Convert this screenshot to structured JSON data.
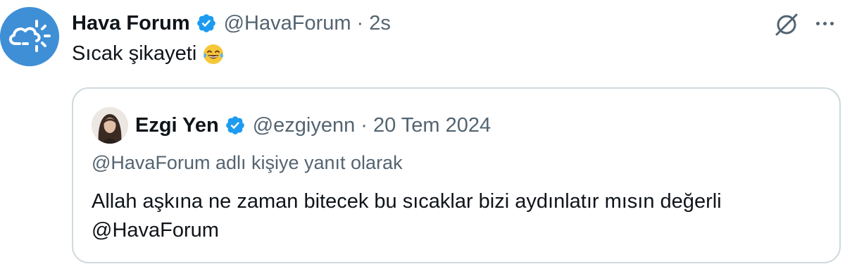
{
  "tweet": {
    "author_name": "Hava Forum",
    "author_handle": "@HavaForum",
    "separator": "·",
    "time": "2s",
    "text": "Sıcak şikayeti",
    "emoji": "face-with-tears-of-joy"
  },
  "quoted_tweet": {
    "author_name": "Ezgi Yen",
    "author_handle": "@ezgiyenn",
    "separator": "·",
    "date": "20 Tem 2024",
    "reply_context": "@HavaForum adlı kişiye yanıt olarak",
    "text_line1": "Allah aşkına ne zaman bitecek bu sıcaklar bizi aydınlatır mısın değerli",
    "text_line2": "@HavaForum"
  },
  "icons": {
    "verified": "verified-badge-icon",
    "grok": "grok-icon",
    "more": "more-icon"
  },
  "colors": {
    "primary_text": "#0f1419",
    "secondary_text": "#536471",
    "verified_blue": "#1d9bf0",
    "avatar_blue": "#3e8fd6",
    "border": "#cfd9de"
  }
}
